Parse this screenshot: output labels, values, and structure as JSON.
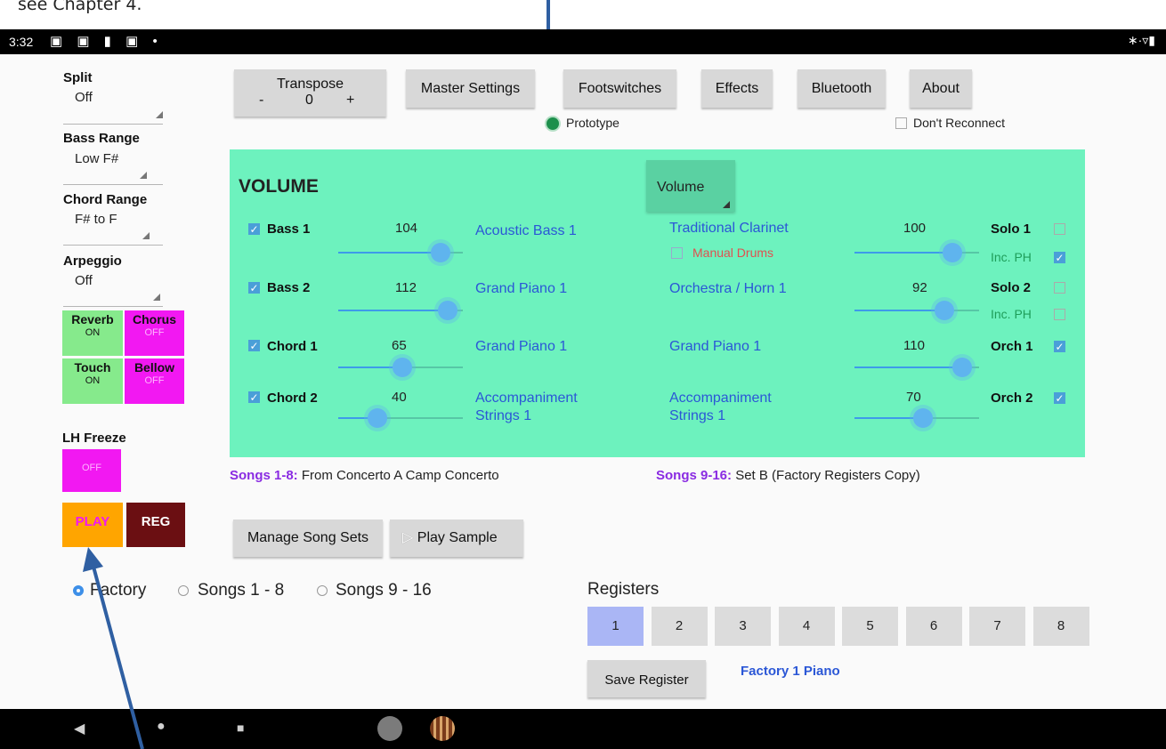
{
  "caption": "see Chapter 4.",
  "status_bar": {
    "time": "3:32",
    "left_icons": "▣ ▣ ▮ ▣ •",
    "right_icons": "∗·▿▮"
  },
  "sidebar": {
    "split": {
      "label": "Split",
      "value": "Off"
    },
    "bass_range": {
      "label": "Bass Range",
      "value": "Low F#"
    },
    "chord_range": {
      "label": "Chord Range",
      "value": "F# to F"
    },
    "arpeggio": {
      "label": "Arpeggio",
      "value": "Off"
    },
    "reverb": {
      "label": "Reverb",
      "state": "ON"
    },
    "chorus": {
      "label": "Chorus",
      "state": "OFF"
    },
    "touch": {
      "label": "Touch",
      "state": "ON"
    },
    "bellow": {
      "label": "Bellow",
      "state": "OFF"
    },
    "lh_freeze": {
      "label": "LH Freeze",
      "state": "OFF"
    },
    "play": "PLAY",
    "reg": "REG"
  },
  "toolbar": {
    "transpose": {
      "label": "Transpose",
      "minus": "-",
      "value": "0",
      "plus": "+"
    },
    "master_settings": "Master Settings",
    "footswitches": "Footswitches",
    "effects": "Effects",
    "bluetooth": "Bluetooth",
    "about": "About",
    "prototype": "Prototype",
    "dont_reconnect": "Don't Reconnect"
  },
  "volume_panel": {
    "title": "VOLUME",
    "dropdown": "Volume",
    "left_channels": [
      {
        "name": "Bass 1",
        "checked": true,
        "value": "104",
        "level": 104,
        "instrument": "Acoustic Bass 1"
      },
      {
        "name": "Bass 2",
        "checked": true,
        "value": "112",
        "level": 112,
        "instrument": "Grand Piano 1"
      },
      {
        "name": "Chord 1",
        "checked": true,
        "value": "65",
        "level": 65,
        "instrument": "Grand Piano 1"
      },
      {
        "name": "Chord 2",
        "checked": true,
        "value": "40",
        "level": 40,
        "instrument": "Accompaniment Strings 1"
      }
    ],
    "right_channels": [
      {
        "instrument": "Traditional Clarinet",
        "value": "100",
        "level": 100,
        "name": "Solo 1",
        "checked": false
      },
      {
        "instrument": "Orchestra / Horn 1",
        "value": "92",
        "level": 92,
        "name": "Solo 2",
        "checked": false
      },
      {
        "instrument": "Grand Piano 1",
        "value": "110",
        "level": 110,
        "name": "Orch 1",
        "checked": true
      },
      {
        "instrument": "Accompaniment Strings 1",
        "value": "70",
        "level": 70,
        "name": "Orch 2",
        "checked": true
      }
    ],
    "manual_drums": "Manual Drums",
    "inc_ph_1": {
      "label": "Inc. PH",
      "checked": true
    },
    "inc_ph_2": {
      "label": "Inc. PH",
      "checked": false
    }
  },
  "songs": {
    "set_a_label": "Songs 1-8:",
    "set_a_value": "From Concerto A Camp Concerto",
    "set_b_label": "Songs 9-16:",
    "set_b_value": "Set B (Factory Registers Copy)"
  },
  "actions": {
    "manage_song_sets": "Manage Song Sets",
    "play_sample": "Play Sample"
  },
  "bank_radios": [
    {
      "label": "Factory",
      "selected": true
    },
    {
      "label": "Songs 1 - 8",
      "selected": false
    },
    {
      "label": "Songs 9 - 16",
      "selected": false
    }
  ],
  "registers": {
    "title": "Registers",
    "items": [
      "1",
      "2",
      "3",
      "4",
      "5",
      "6",
      "7",
      "8"
    ],
    "selected": "1",
    "save_button": "Save Register",
    "current_name": "Factory 1 Piano"
  },
  "colors": {
    "panel": "#6df2be",
    "on_tile": "#86ea8c",
    "off_tile": "#f218f2",
    "play": "#ffa500",
    "reg": "#6b0f12",
    "instrument_text": "#2b57d6",
    "song_label": "#8a2be2",
    "selected_register": "#aab6f5",
    "annotation_arrow": "#2f5fa2"
  }
}
